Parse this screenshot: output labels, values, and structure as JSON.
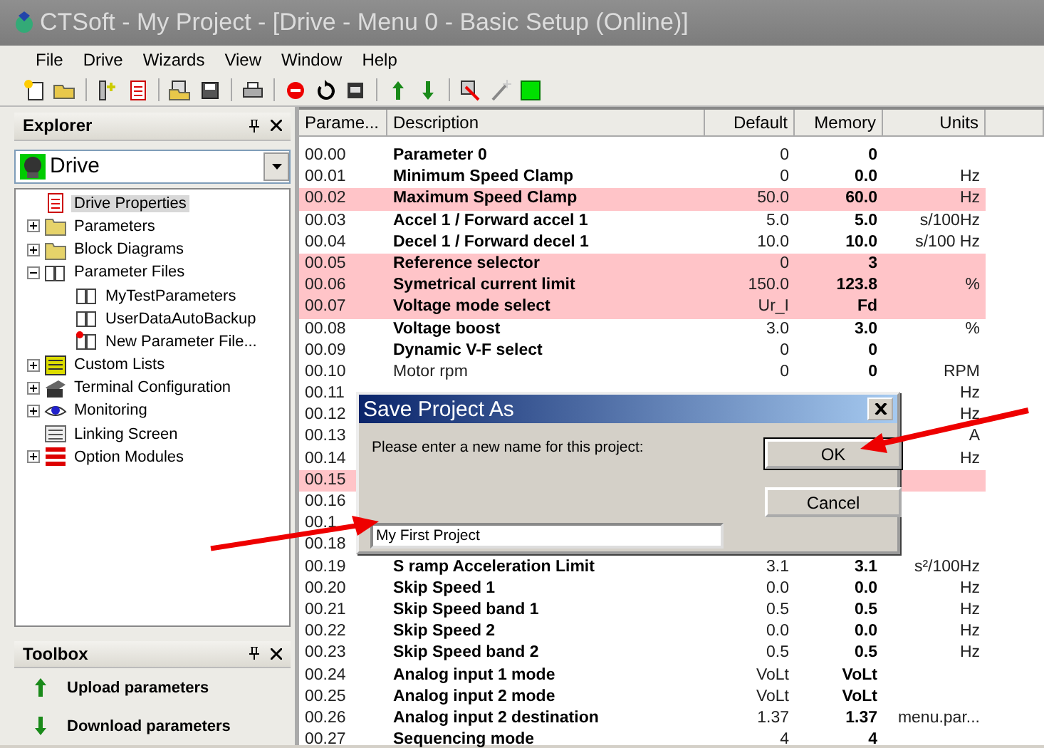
{
  "window": {
    "title": "CTSoft - My Project - [Drive - Menu 0 - Basic Setup  (Online)]"
  },
  "menu": [
    "File",
    "Drive",
    "Wizards",
    "View",
    "Window",
    "Help"
  ],
  "explorer": {
    "title": "Explorer",
    "device": "Drive",
    "tree": [
      {
        "label": "Drive Properties",
        "kind": "page",
        "expandable": false,
        "selected": true
      },
      {
        "label": "Parameters",
        "kind": "folder",
        "expandable": true,
        "expanded": false,
        "selected": false
      },
      {
        "label": "Block Diagrams",
        "kind": "folder",
        "expandable": true,
        "expanded": false,
        "selected": false
      },
      {
        "label": "Parameter Files",
        "kind": "book",
        "expandable": true,
        "expanded": true,
        "selected": false,
        "children": [
          {
            "label": "MyTestParameters",
            "kind": "book",
            "expandable": false,
            "selected": false
          },
          {
            "label": "UserDataAutoBackup",
            "kind": "book",
            "expandable": false,
            "selected": false
          },
          {
            "label": "New Parameter File...",
            "kind": "book-new",
            "expandable": false,
            "selected": false
          }
        ]
      },
      {
        "label": "Custom Lists",
        "kind": "list",
        "expandable": true,
        "expanded": false,
        "selected": false
      },
      {
        "label": "Terminal Configuration",
        "kind": "terminal",
        "expandable": true,
        "expanded": false,
        "selected": false
      },
      {
        "label": "Monitoring",
        "kind": "eye",
        "expandable": true,
        "expanded": false,
        "selected": false
      },
      {
        "label": "Linking Screen",
        "kind": "lines",
        "expandable": false,
        "selected": false
      },
      {
        "label": "Option Modules",
        "kind": "modules",
        "expandable": true,
        "expanded": false,
        "selected": false
      }
    ]
  },
  "toolbox": {
    "title": "Toolbox",
    "items": [
      {
        "label": "Upload parameters",
        "kind": "up"
      },
      {
        "label": "Download parameters",
        "kind": "down"
      }
    ]
  },
  "table": {
    "columns": [
      "Parame...",
      "Description",
      "Default",
      "Memory",
      "Units"
    ],
    "rows": [
      {
        "param": "00.00",
        "description": "Parameter 0",
        "bold": true,
        "default": "0",
        "memory": "0",
        "highlighted": false
      },
      {
        "param": "00.01",
        "description": "Minimum Speed Clamp",
        "bold": true,
        "default": "0",
        "memory": "0.0",
        "units": "Hz",
        "highlighted": false
      },
      {
        "param": "00.02",
        "description": "Maximum Speed Clamp",
        "bold": true,
        "default": "50.0",
        "memory": "60.0",
        "units": "Hz",
        "highlighted": true
      },
      {
        "param": "00.03",
        "description": "Accel 1 / Forward accel 1",
        "bold": true,
        "default": "5.0",
        "memory": "5.0",
        "units": "s/100Hz",
        "highlighted": false
      },
      {
        "param": "00.04",
        "description": "Decel 1 / Forward decel 1",
        "bold": true,
        "default": "10.0",
        "memory": "10.0",
        "units": "s/100 Hz",
        "highlighted": false
      },
      {
        "param": "00.05",
        "description": "Reference selector",
        "bold": true,
        "default": "0",
        "memory": "3",
        "highlighted": true
      },
      {
        "param": "00.06",
        "description": "Symetrical current limit",
        "bold": true,
        "default": "150.0",
        "memory": "123.8",
        "units": "%",
        "highlighted": true
      },
      {
        "param": "00.07",
        "description": "Voltage mode select",
        "bold": true,
        "default": "Ur_I",
        "memory": "Fd",
        "highlighted": true
      },
      {
        "param": "00.08",
        "description": "Voltage boost",
        "bold": true,
        "default": "3.0",
        "memory": "3.0",
        "units": "%",
        "highlighted": false
      },
      {
        "param": "00.09",
        "description": "Dynamic V-F select",
        "bold": true,
        "default": "0",
        "memory": "0",
        "highlighted": false
      },
      {
        "param": "00.10",
        "description": "Motor rpm",
        "bold": false,
        "default": "0",
        "memory": "0",
        "units": "RPM",
        "highlighted": false
      },
      {
        "param": "00.11",
        "units": "Hz",
        "highlighted": false
      },
      {
        "param": "00.12",
        "units": "Hz",
        "highlighted": false
      },
      {
        "param": "00.13",
        "units": "A",
        "highlighted": false
      },
      {
        "param": "00.14",
        "units": "Hz",
        "highlighted": false
      },
      {
        "param": "00.15",
        "highlighted": true
      },
      {
        "param": "00.16",
        "highlighted": false
      },
      {
        "param": "00.1",
        "highlighted": false
      },
      {
        "param": "00.18",
        "highlighted": false
      },
      {
        "param": "00.19",
        "description": "S ramp Acceleration Limit",
        "bold": true,
        "default": "3.1",
        "memory": "3.1",
        "units": "s²/100Hz",
        "highlighted": false
      },
      {
        "param": "00.20",
        "description": "Skip Speed 1",
        "bold": true,
        "default": "0.0",
        "memory": "0.0",
        "units": "Hz",
        "highlighted": false
      },
      {
        "param": "00.21",
        "description": "Skip Speed band 1",
        "bold": true,
        "default": "0.5",
        "memory": "0.5",
        "units": "Hz",
        "highlighted": false
      },
      {
        "param": "00.22",
        "description": "Skip Speed 2",
        "bold": true,
        "default": "0.0",
        "memory": "0.0",
        "units": "Hz",
        "highlighted": false
      },
      {
        "param": "00.23",
        "description": "Skip Speed band 2",
        "bold": true,
        "default": "0.5",
        "memory": "0.5",
        "units": "Hz",
        "highlighted": false
      },
      {
        "param": "00.24",
        "description": "Analog input 1 mode",
        "bold": true,
        "default": "VoLt",
        "memory": "VoLt",
        "highlighted": false
      },
      {
        "param": "00.25",
        "description": "Analog input 2 mode",
        "bold": true,
        "default": "VoLt",
        "memory": "VoLt",
        "highlighted": false
      },
      {
        "param": "00.26",
        "description": "Analog input 2 destination",
        "bold": true,
        "default": "1.37",
        "memory": "1.37",
        "units": "menu.par...",
        "highlighted": false
      },
      {
        "param": "00.27",
        "description": "Sequencing mode",
        "bold": true,
        "default": "4",
        "memory": "4",
        "highlighted": false
      }
    ]
  },
  "dialog": {
    "title": "Save Project As",
    "prompt": "Please enter a new name for this project:",
    "value": "My First Project",
    "buttons": [
      {
        "label": "OK",
        "focused": true
      },
      {
        "label": "Cancel",
        "focused": false
      }
    ]
  }
}
